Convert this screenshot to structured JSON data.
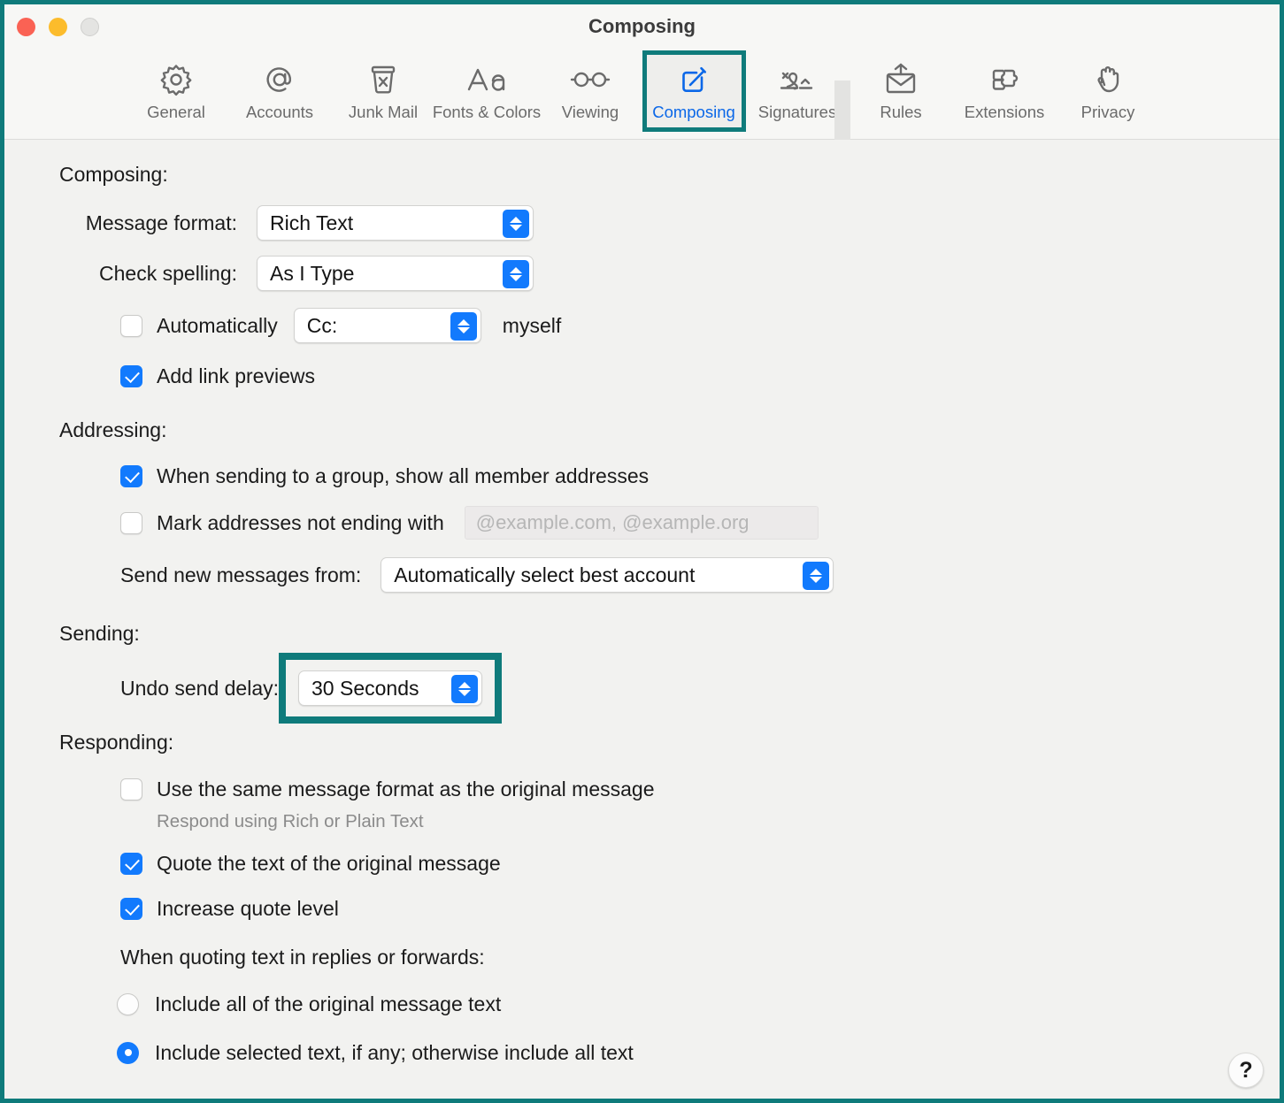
{
  "window": {
    "title": "Composing",
    "traffic_lights": [
      {
        "name": "close",
        "color": "#fa6254"
      },
      {
        "name": "minimize",
        "color": "#fcbc2c"
      },
      {
        "name": "zoom",
        "color": "#e4e4e2"
      }
    ]
  },
  "accent": {
    "highlight": "#0f7b7b",
    "control_blue": "#127afd",
    "selected_label": "#0a67e8"
  },
  "toolbar": {
    "tabs": [
      {
        "label": "General",
        "icon": "gear-icon",
        "selected": false
      },
      {
        "label": "Accounts",
        "icon": "at-sign-icon",
        "selected": false
      },
      {
        "label": "Junk Mail",
        "icon": "junk-bin-icon",
        "selected": false
      },
      {
        "label": "Fonts & Colors",
        "icon": "aa-font-icon",
        "selected": false
      },
      {
        "label": "Viewing",
        "icon": "glasses-icon",
        "selected": false
      },
      {
        "label": "Composing",
        "icon": "compose-pencil-icon",
        "selected": true
      },
      {
        "label": "Signatures",
        "icon": "signature-icon",
        "selected": false
      },
      {
        "label": "Rules",
        "icon": "rules-envelope-icon",
        "selected": false
      },
      {
        "label": "Extensions",
        "icon": "puzzle-piece-icon",
        "selected": false
      },
      {
        "label": "Privacy",
        "icon": "hand-icon",
        "selected": false
      }
    ]
  },
  "composing": {
    "heading": "Composing:",
    "message_format": {
      "label": "Message format:",
      "value": "Rich Text"
    },
    "check_spelling": {
      "label": "Check spelling:",
      "value": "As I Type"
    },
    "auto_cc": {
      "checkbox_label": "Automatically",
      "checked": false,
      "value": "Cc:",
      "suffix": "myself"
    },
    "add_link_previews": {
      "label": "Add link previews",
      "checked": true
    }
  },
  "addressing": {
    "heading": "Addressing:",
    "group_addresses": {
      "label": "When sending to a group, show all member addresses",
      "checked": true
    },
    "mark_addresses": {
      "label": "Mark addresses not ending with",
      "checked": false,
      "placeholder": "@example.com, @example.org",
      "value": ""
    },
    "send_from": {
      "label": "Send new messages from:",
      "value": "Automatically select best account"
    }
  },
  "sending": {
    "heading": "Sending:",
    "undo_send_delay": {
      "label": "Undo send delay:",
      "value": "30 Seconds",
      "highlighted": true
    }
  },
  "responding": {
    "heading": "Responding:",
    "same_format": {
      "label": "Use the same message format as the original message",
      "sub_label": "Respond using Rich or Plain Text",
      "checked": false
    },
    "quote_text": {
      "label": "Quote the text of the original message",
      "checked": true
    },
    "increase_quote": {
      "label": "Increase quote level",
      "checked": true
    },
    "quoting_heading": "When quoting text in replies or forwards:",
    "quote_options": [
      {
        "label": "Include all of the original message text",
        "selected": false
      },
      {
        "label": "Include selected text, if any; otherwise include all text",
        "selected": true
      }
    ]
  },
  "help": {
    "label": "?"
  }
}
